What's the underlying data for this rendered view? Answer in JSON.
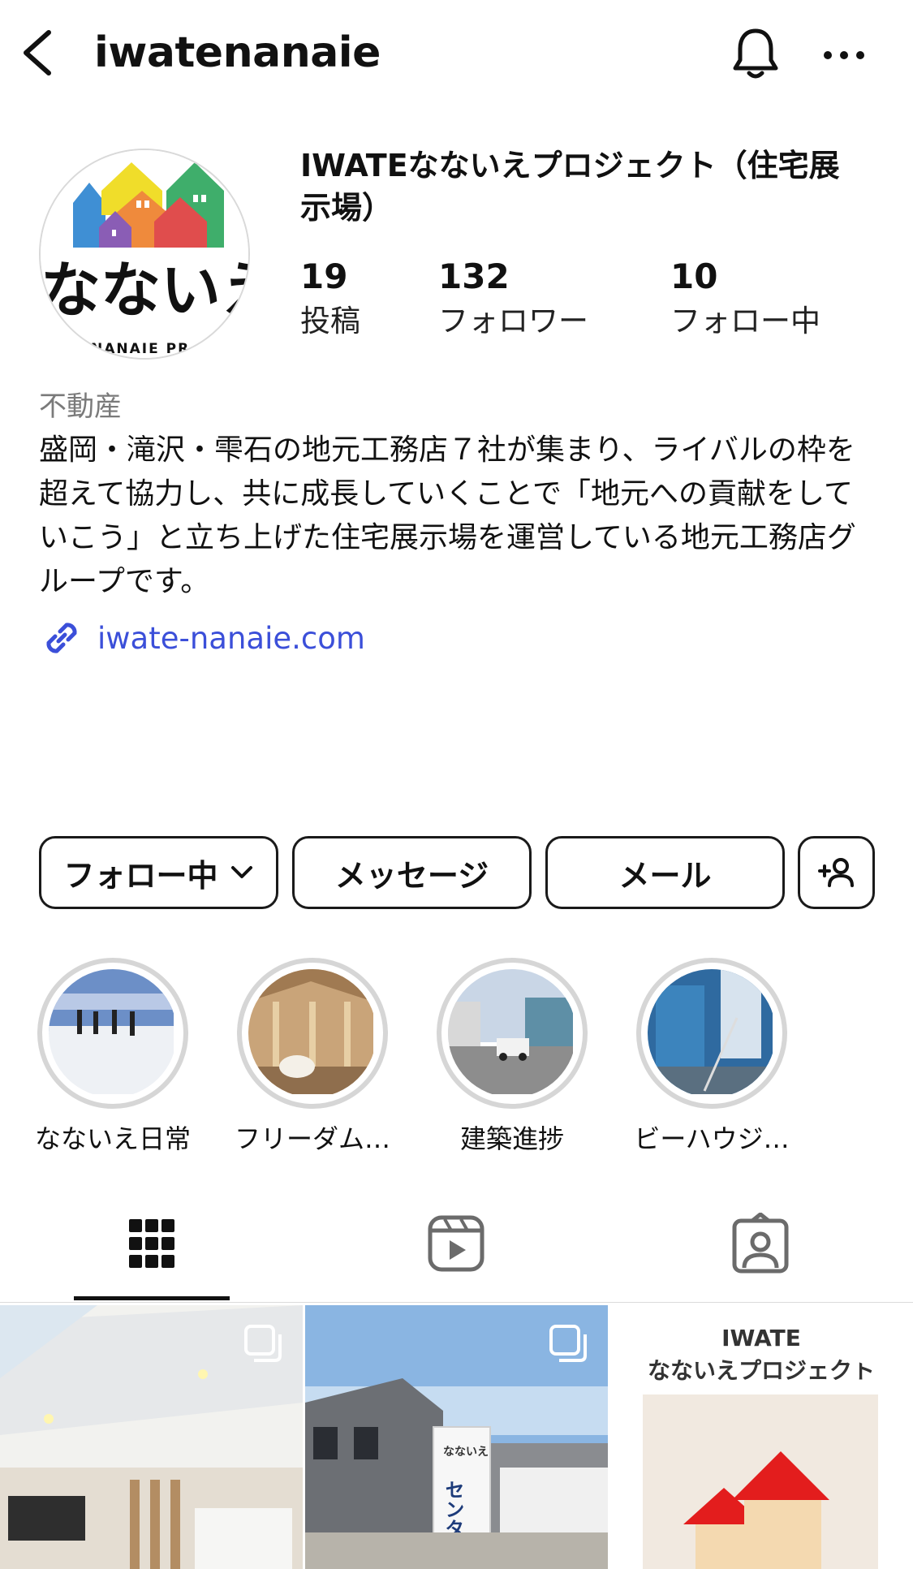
{
  "header": {
    "title": "iwatenanaie",
    "icons": [
      "back-icon",
      "bell-icon",
      "more-icon"
    ]
  },
  "profile": {
    "name": "IWATEなないえプロジェクト（住宅展示場）",
    "avatar_text": "なないえ",
    "avatar_subtext": "NANAIE PR",
    "category": "不動産",
    "bio": "盛岡・滝沢・雫石の地元工務店７社が集まり、ライバルの枠を超えて協力し、共に成長していくことで「地元への貢献をしていこう」と立ち上げた住宅展示場を運営している地元工務店グループです。",
    "link": "iwate-nanaie.com"
  },
  "stats": [
    {
      "value": "19",
      "label": "投稿"
    },
    {
      "value": "132",
      "label": "フォロワー"
    },
    {
      "value": "10",
      "label": "フォロー中"
    }
  ],
  "buttons": {
    "following": "フォロー中",
    "message": "メッセージ",
    "mail": "メール"
  },
  "highlights": [
    {
      "label": "なないえ日常"
    },
    {
      "label": "フリーダム…"
    },
    {
      "label": "建築進捗"
    },
    {
      "label": "ビーハウジ…"
    }
  ],
  "posts": [
    {
      "type": "carousel"
    },
    {
      "type": "carousel",
      "sign_text": "センターハウ",
      "logo_text": "なないえ"
    },
    {
      "type": "reel",
      "title_line1": "IWATE",
      "title_line2": "なないえプロジェクト"
    }
  ],
  "colors": {
    "link": "#3b4fd9",
    "text": "#111111",
    "muted": "#7a7a7a",
    "ring": "#d6d6d6"
  }
}
